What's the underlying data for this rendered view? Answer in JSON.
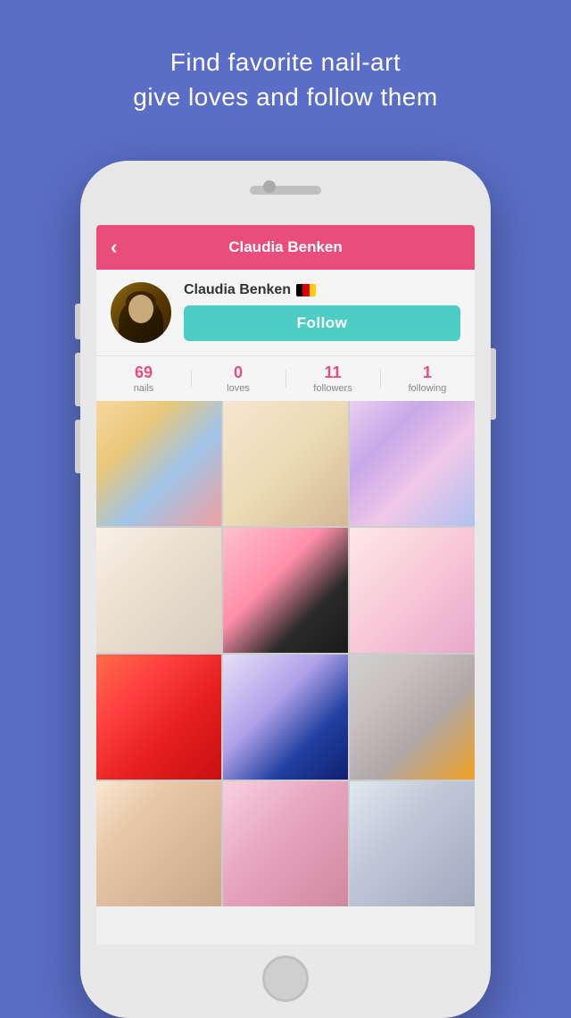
{
  "headline": {
    "line1": "Find favorite nail-art",
    "line2": "give loves and follow them"
  },
  "app": {
    "header": {
      "back_icon": "‹",
      "title": "Claudia Benken"
    },
    "profile": {
      "name": "Claudia Benken",
      "flag": "🇩🇪",
      "follow_button": "Follow"
    },
    "stats": [
      {
        "number": "69",
        "label": "nails"
      },
      {
        "number": "0",
        "label": "loves"
      },
      {
        "number": "11",
        "label": "followers"
      },
      {
        "number": "1",
        "label": "following"
      }
    ],
    "grid": {
      "items": [
        {
          "id": 1,
          "class": "nail-1"
        },
        {
          "id": 2,
          "class": "nail-2"
        },
        {
          "id": 3,
          "class": "nail-3"
        },
        {
          "id": 4,
          "class": "nail-4"
        },
        {
          "id": 5,
          "class": "nail-5"
        },
        {
          "id": 6,
          "class": "nail-6"
        },
        {
          "id": 7,
          "class": "nail-7"
        },
        {
          "id": 8,
          "class": "nail-8"
        },
        {
          "id": 9,
          "class": "nail-9"
        },
        {
          "id": 10,
          "class": "nail-10"
        },
        {
          "id": 11,
          "class": "nail-11"
        },
        {
          "id": 12,
          "class": "nail-12"
        }
      ]
    }
  }
}
